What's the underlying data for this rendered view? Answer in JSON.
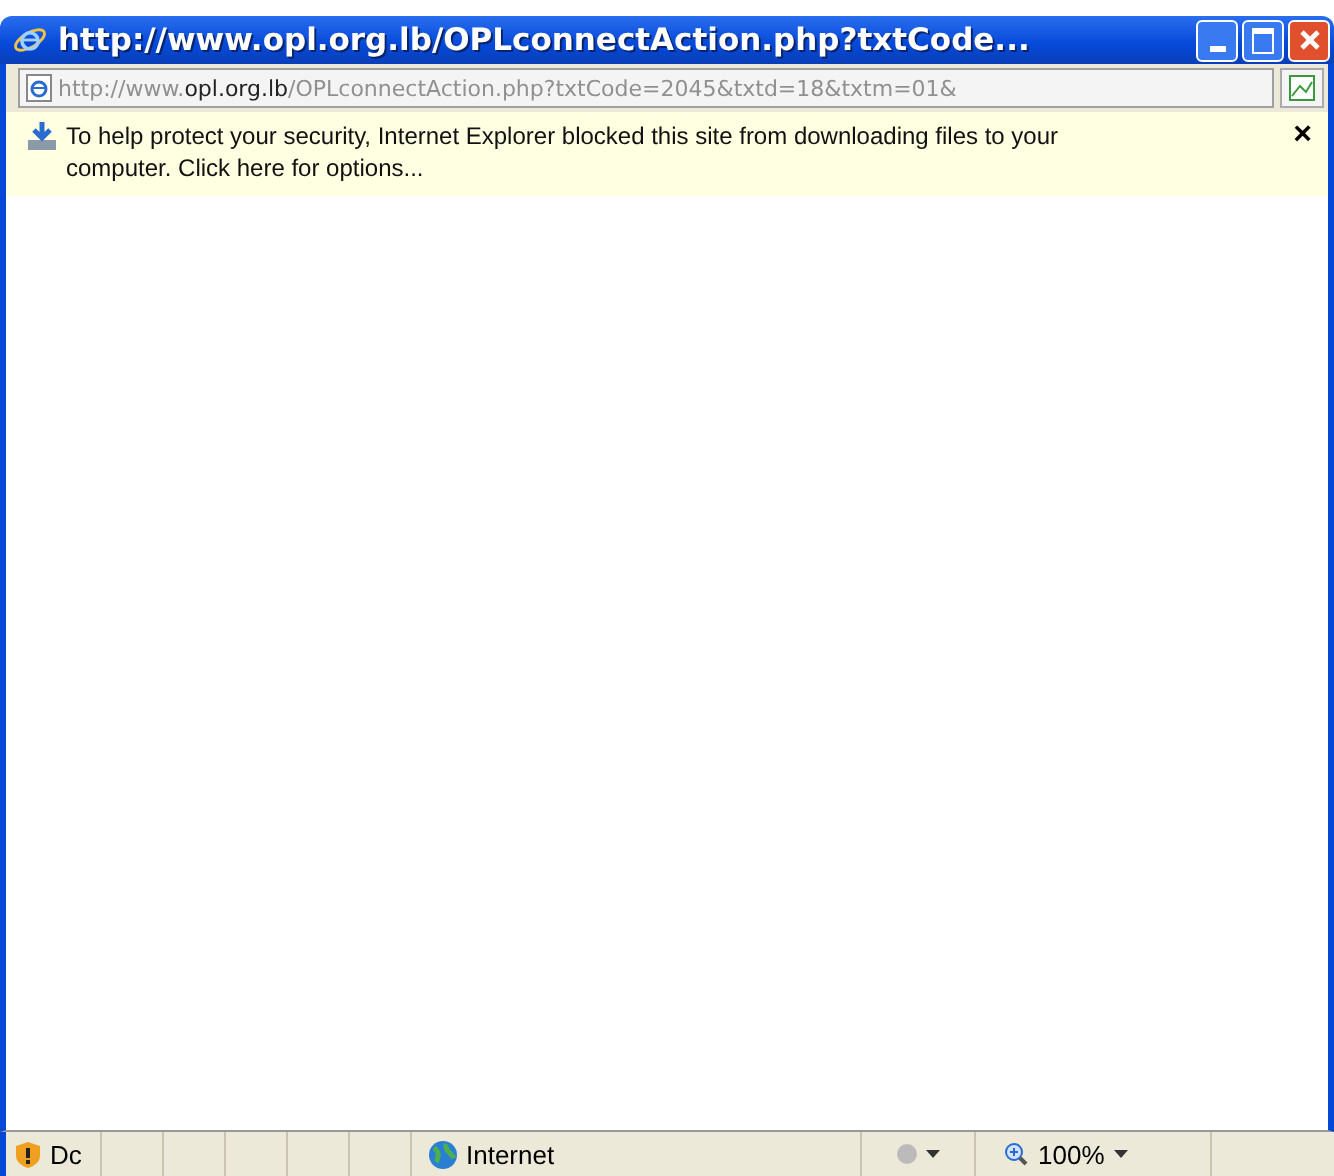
{
  "window": {
    "title": "http://www.opl.org.lb/OPLconnectAction.php?txtCode..."
  },
  "address_bar": {
    "prefix": "http://www.",
    "domain": "opl.org.lb",
    "path": "/OPLconnectAction.php?txtCode=2045&txtd=18&txtm=01&"
  },
  "information_bar": {
    "message": "To help protect your security, Internet Explorer blocked this site from downloading files to your computer. Click here for options...",
    "close": "×"
  },
  "status_bar": {
    "status": "Dc",
    "zone": "Internet",
    "zoom": "100%"
  }
}
